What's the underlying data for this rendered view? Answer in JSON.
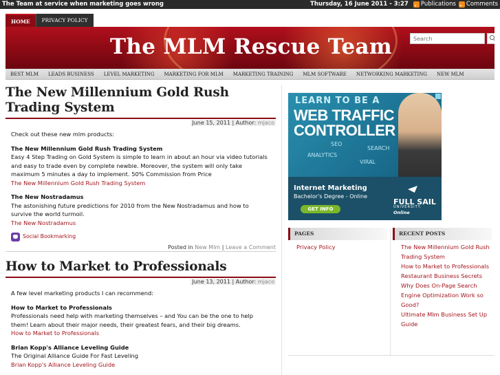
{
  "topbar": {
    "tagline": "The Team at service when marketing goes wrong",
    "date": "Thursday, 16 June 2011 - 3:27",
    "publications": "Publications",
    "comments": "Comments"
  },
  "pagenav": {
    "home": "HOME",
    "privacy": "PRIVACY POLICY"
  },
  "header": {
    "title": "The MLM Rescue Team",
    "search_placeholder": "Search"
  },
  "categories": [
    "BEST MLM",
    "LEADS BUSINESS",
    "LEVEL MARKETING",
    "MARKETING FOR MLM",
    "MARKETING TRAINING",
    "MLM SOFTWARE",
    "NETWORKING MARKETING",
    "NEW MLM"
  ],
  "posts": [
    {
      "title": "The New Millennium Gold Rush Trading System",
      "date": "June 15, 2011",
      "author_label": "| Author:",
      "author": "mjaco",
      "intro": "Check out these new mlm products:",
      "items": [
        {
          "heading": "The New Millennium Gold Rush Trading System",
          "text": "Easy 4 Step Trading on Gold System is simple to learn in about an hour via video tutorials and easy to trade even by complete newbie. Moreover, the system will only take maximum 5 minutes a day to implement. 50% Commission from Price",
          "link": "The New Millennium Gold Rush Trading System"
        },
        {
          "heading": "The New Nostradamus",
          "text": "The astonishing future predictions for 2010 from the New Nostradamus and how to survive the world turmoil.",
          "link": "The New Nostradamus"
        }
      ],
      "social": "Social Bookmarking",
      "posted_in": "Posted in",
      "category": "New Mlm",
      "sep": "|",
      "comment_link": "Leave a Comment"
    },
    {
      "title": "How to Market to Professionals",
      "date": "June 13, 2011",
      "author_label": "| Author:",
      "author": "mjaco",
      "intro": "A few level marketing products I can recommend:",
      "items": [
        {
          "heading": "How to Market to Professionals",
          "text": "Professionals need help with marketing themselves – and You can be the one to help them! Learn about their major needs, their greatest fears, and their big dreams.",
          "link": "How to Market to Professionals"
        },
        {
          "heading": "Brian Kopp's Alliance Leveling Guide",
          "text": "The Original Alliance Guide For Fast Leveling",
          "link": "Brian Kopp's Alliance Leveling Guide"
        }
      ]
    }
  ],
  "ad": {
    "line1": "LEARN TO BE A",
    "line2": "WEB TRAFFIC",
    "line3": "CONTROLLER",
    "words": [
      "SEO",
      "SEARCH",
      "ANALYTICS",
      "VIRAL"
    ],
    "program": "Internet Marketing",
    "degree": "Bachelor's Degree - Online",
    "cta": "GET INFO",
    "school": "FULL SAIL",
    "school_sub": "UNIVERSITY.",
    "school_online": "Online"
  },
  "sidebar": {
    "pages_title": "PAGES",
    "pages": [
      "Privacy Policy"
    ],
    "recent_title": "RECENT POSTS",
    "recent": [
      "The New Millennium Gold Rush Trading System",
      "How to Market to Professionals",
      "Restaurant Business Secrets",
      "Why Does On-Page Search Engine Optimization Work so Good?",
      "Ultimate Mlm Business Set Up Guide"
    ]
  }
}
